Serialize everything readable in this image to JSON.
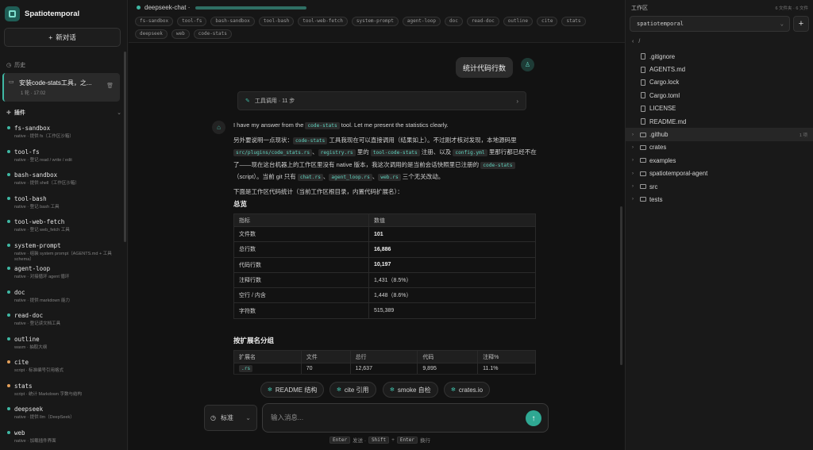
{
  "app": {
    "name": "Spatiotemporal",
    "new_chat": "新对话"
  },
  "history": {
    "label": "历史",
    "items": [
      {
        "title": "安装code-stats工具，之...",
        "meta": "1 轮 · 17:02"
      }
    ]
  },
  "plugins": {
    "label": "插件",
    "items": [
      {
        "name": "fs-sandbox",
        "desc": "native · 提供 fs（工作区沙箱）",
        "status": "native"
      },
      {
        "name": "tool-fs",
        "desc": "native · 登记 read / write / edit",
        "status": "native"
      },
      {
        "name": "bash-sandbox",
        "desc": "native · 提供 shell（工作区沙箱）",
        "status": "native"
      },
      {
        "name": "tool-bash",
        "desc": "native · 登记 bash 工具",
        "status": "native"
      },
      {
        "name": "tool-web-fetch",
        "desc": "native · 登记 web_fetch 工具",
        "status": "native"
      },
      {
        "name": "system-prompt",
        "desc": "native · 组装 system prompt（AGENTS.md + 工具 schema）",
        "status": "native"
      },
      {
        "name": "agent-loop",
        "desc": "native · 对接循环 agent 循环",
        "status": "native"
      },
      {
        "name": "doc",
        "desc": "native · 提供 markdown 能力",
        "status": "native"
      },
      {
        "name": "read-doc",
        "desc": "native · 登记读文档工具",
        "status": "native"
      },
      {
        "name": "outline",
        "desc": "wasm · 抽取大纲",
        "status": "native"
      },
      {
        "name": "cite",
        "desc": "script · 标准编号引用格式",
        "status": "script"
      },
      {
        "name": "stats",
        "desc": "script · 统计 Markdown 字数与结构",
        "status": "script"
      },
      {
        "name": "deepseek",
        "desc": "native · 提供 llm（DeepSeek）",
        "status": "native"
      },
      {
        "name": "web",
        "desc": "native · 加载插件界面",
        "status": "native"
      }
    ]
  },
  "session": {
    "name": "deepseek-chat ·",
    "tags": [
      "fs-sandbox",
      "tool-fs",
      "bash-sandbox",
      "tool-bash",
      "tool-web-fetch",
      "system-prompt",
      "agent-loop",
      "doc",
      "read-doc",
      "outline",
      "cite",
      "stats",
      "deepseek",
      "web",
      "code-stats"
    ]
  },
  "chat": {
    "user_message": "统计代码行数",
    "tool_call": "工具调用 · 11 步",
    "intro_a": "I have my answer from the ",
    "intro_code": "code-stats",
    "intro_b": " tool. Let me present the statistics clearly.",
    "p2": {
      "a": "另外要说明一点现状：",
      "c1": "code-stats",
      "b": " 工具我现在可以直接调用（结果如上）。不过刚才核对发现，本地源码里 ",
      "c2": "src/plugins/code_stats.rs",
      "d": "、",
      "c3": "registry.rs",
      "e": " 里的 ",
      "c4": "tool-code-stats",
      "f": " 注册、以及 ",
      "c5": "config.yml",
      "g": " 里那行都已经不在了——现在这台机器上的工作区里没有 native 版本，我这次调用的是当前会话快照里已注册的 ",
      "c6": "code-stats",
      "h": "（script）。当前 git 只有 ",
      "c7": "chat.rs",
      "i": "、",
      "c8": "agent_loop.rs",
      "j": "、",
      "c9": "web.rs",
      "k": " 三个无关改动。"
    },
    "p3": "下面是工作区代码统计（当前工作区根目录，内置代码扩展名）：",
    "overview_heading": "总览",
    "overview_headers": [
      "指标",
      "数值"
    ],
    "overview_rows": [
      [
        "文件数",
        "101"
      ],
      [
        "总行数",
        "16,886"
      ],
      [
        "代码行数",
        "10,197"
      ],
      [
        "注释行数",
        "1,431（8.5%）"
      ],
      [
        "空行 / 内含",
        "1,448（8.6%）"
      ],
      [
        "字符数",
        "515,389"
      ]
    ],
    "ext_heading": "按扩展名分组",
    "ext_headers": [
      "扩展名",
      "文件",
      "总行",
      "代码",
      "注释%"
    ],
    "ext_rows": [
      [
        ".rs",
        "70",
        "12,637",
        "9,895",
        "11.1%"
      ]
    ]
  },
  "suggestions": [
    "README 结构",
    "cite 引用",
    "smoke 自检",
    "crates.io"
  ],
  "composer": {
    "mode": "标准",
    "placeholder": "输入消息...",
    "hint_enter": "Enter",
    "hint_send": "发送 ·",
    "hint_shift": "Shift",
    "hint_plus": "+",
    "hint_enter2": "Enter",
    "hint_newline": "换行"
  },
  "workspace": {
    "title": "工作区",
    "meta": "6 文件夹 · 6 文件",
    "select": "spatiotemporal",
    "path": "/",
    "files": [
      {
        "name": ".gitignore",
        "type": "file"
      },
      {
        "name": "AGENTS.md",
        "type": "file"
      },
      {
        "name": "Cargo.lock",
        "type": "file"
      },
      {
        "name": "Cargo.toml",
        "type": "file"
      },
      {
        "name": "LICENSE",
        "type": "file"
      },
      {
        "name": "README.md",
        "type": "file"
      },
      {
        "name": ".github",
        "type": "folder",
        "badge": "1 项"
      },
      {
        "name": "crates",
        "type": "folder"
      },
      {
        "name": "examples",
        "type": "folder"
      },
      {
        "name": "spatiotemporal-agent",
        "type": "folder"
      },
      {
        "name": "src",
        "type": "folder"
      },
      {
        "name": "tests",
        "type": "folder"
      }
    ]
  },
  "colors": {
    "accent": "#3fb8a4",
    "script": "#e3a05a"
  }
}
